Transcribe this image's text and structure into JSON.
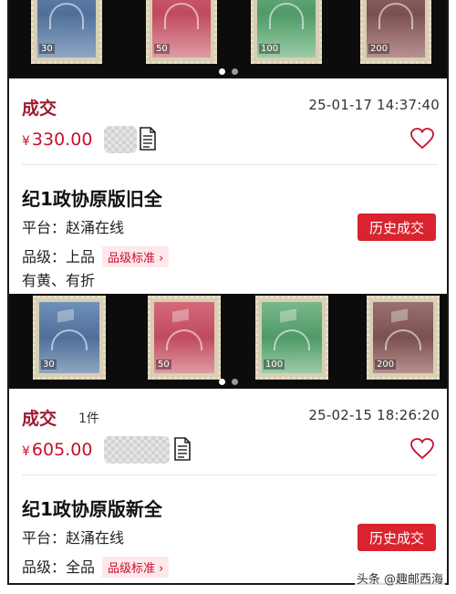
{
  "listings": [
    {
      "status": "成交",
      "quantity": "",
      "time": "25-01-17 14:37:40",
      "price_symbol": "¥",
      "price": "330.00",
      "title": "纪1政协原版旧全",
      "platform_label": "平台：",
      "platform_value": "赵涌在线",
      "grade_label": "品级：",
      "grade_value": "上品",
      "grade_standard": "品级标准",
      "history_button": "历史成交",
      "note": "有黄、有折"
    },
    {
      "status": "成交",
      "quantity": "1件",
      "time": "25-02-15 18:26:20",
      "price_symbol": "¥",
      "price": "605.00",
      "title": "纪1政协原版新全",
      "platform_label": "平台：",
      "platform_value": "赵涌在线",
      "grade_label": "品级：",
      "grade_value": "全品",
      "grade_standard": "品级标准",
      "history_button": "历史成交"
    }
  ],
  "carousel": {
    "slides": 2,
    "active_index": 0
  },
  "stamp_values": [
    "30",
    "50",
    "100",
    "200"
  ],
  "credit": "头条 @趣邮西海",
  "colors": {
    "status": "#9e1b32",
    "price": "#c8102e",
    "button": "#d9232e"
  }
}
